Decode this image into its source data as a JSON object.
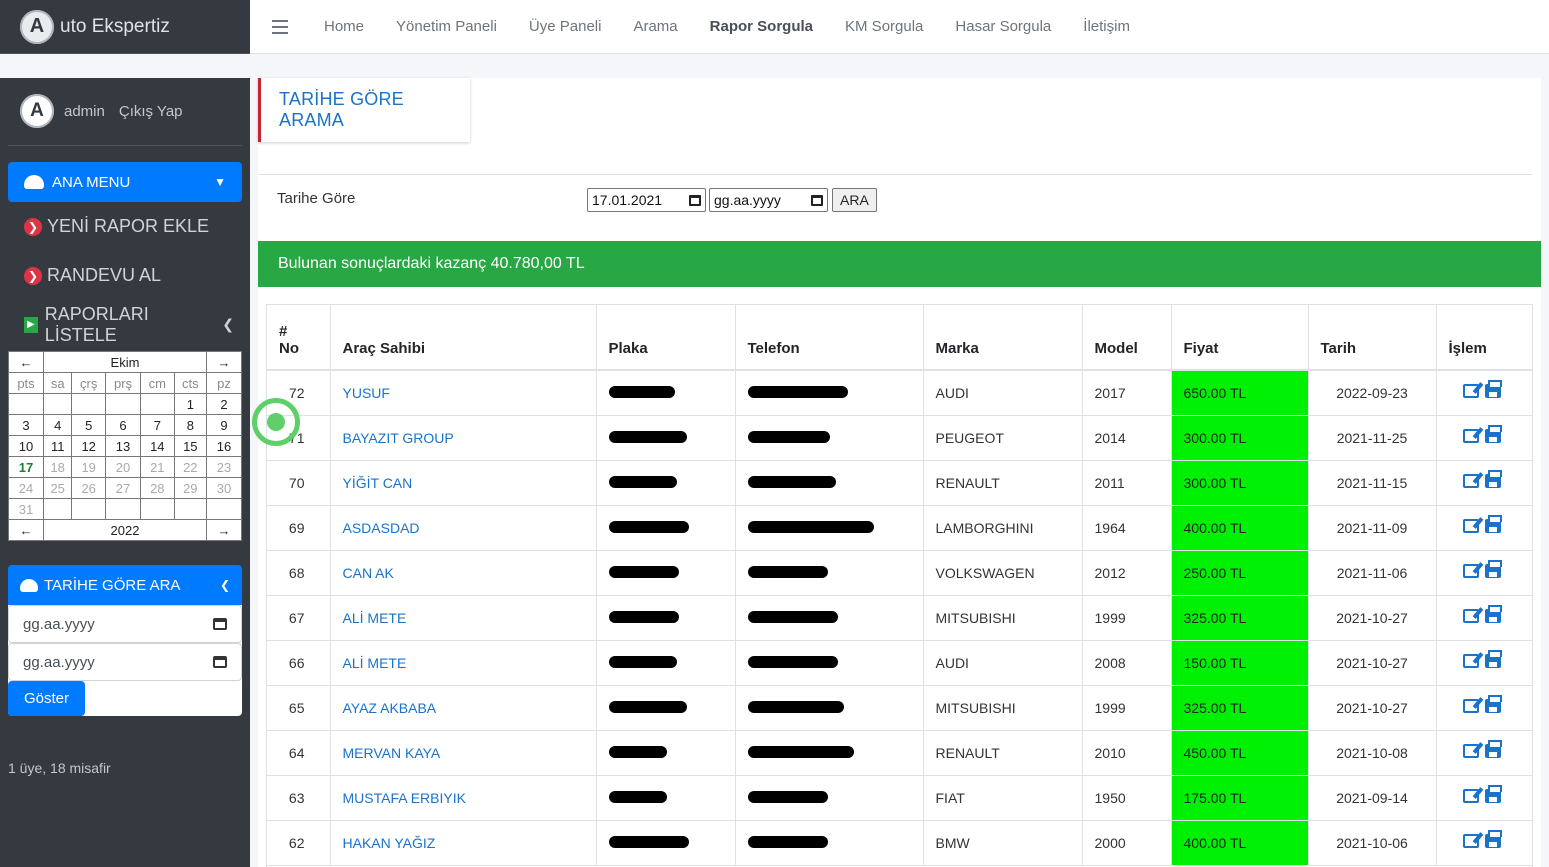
{
  "brand": {
    "logo_letter": "A",
    "text": "uto Ekspertiz"
  },
  "topnav": {
    "items": [
      "Home",
      "Yönetim Paneli",
      "Üye Paneli",
      "Arama",
      "Rapor Sorgula",
      "KM Sorgula",
      "Hasar Sorgula",
      "İletişim"
    ],
    "active": "Rapor Sorgula"
  },
  "sidebar": {
    "user": {
      "avatar_letter": "A",
      "name": "admin",
      "logout": "Çıkış Yap"
    },
    "main_menu": "ANA MENU",
    "items": [
      "YENİ RAPOR EKLE",
      "RANDEVU AL",
      "RAPORLARI LİSTELE"
    ],
    "calendar": {
      "month": "Ekim",
      "year": "2022",
      "days_of_week": [
        "pts",
        "sa",
        "çrş",
        "prş",
        "cm",
        "cts",
        "pz"
      ],
      "weeks": [
        [
          "",
          "",
          "",
          "",
          "",
          "1",
          "2"
        ],
        [
          "3",
          "4",
          "5",
          "6",
          "7",
          "8",
          "9"
        ],
        [
          "10",
          "11",
          "12",
          "13",
          "14",
          "15",
          "16"
        ],
        [
          "17",
          "18",
          "19",
          "20",
          "21",
          "22",
          "23"
        ],
        [
          "24",
          "25",
          "26",
          "27",
          "28",
          "29",
          "30"
        ],
        [
          "31",
          "",
          "",
          "",
          "",
          "",
          ""
        ]
      ],
      "today": "17"
    },
    "date_search": {
      "title": "TARİHE GÖRE ARA",
      "from_placeholder": "gg.aa.yyyy",
      "to_placeholder": "gg.aa.yyyy",
      "button": "Göster"
    },
    "online": "1 üye, 18 misafir"
  },
  "content": {
    "title": "TARİHE GÖRE ARAMA",
    "filter_label": "Tarihe Göre",
    "date_from": "17.01.2021",
    "date_to": "gg.aa.yyyy",
    "search_button": "ARA",
    "alert": "Bulunan sonuçlardaki kazanç 40.780,00 TL",
    "table": {
      "headers": {
        "hash": "#",
        "no": "No",
        "owner": "Araç Sahibi",
        "plate": "Plaka",
        "phone": "Telefon",
        "brand": "Marka",
        "model": "Model",
        "price": "Fiyat",
        "date": "Tarih",
        "action": "İşlem"
      },
      "rows": [
        {
          "no": "72",
          "owner": "YUSUF",
          "brand": "AUDI",
          "model": "2017",
          "price": "650.00 TL",
          "date": "2022-09-23"
        },
        {
          "no": "71",
          "owner": "BAYAZIT GROUP",
          "brand": "PEUGEOT",
          "model": "2014",
          "price": "300.00 TL",
          "date": "2021-11-25"
        },
        {
          "no": "70",
          "owner": "YİĞİT CAN",
          "brand": "RENAULT",
          "model": "2011",
          "price": "300.00 TL",
          "date": "2021-11-15"
        },
        {
          "no": "69",
          "owner": "ASDASDAD",
          "brand": "LAMBORGHINI",
          "model": "1964",
          "price": "400.00 TL",
          "date": "2021-11-09"
        },
        {
          "no": "68",
          "owner": "CAN AK",
          "brand": "VOLKSWAGEN",
          "model": "2012",
          "price": "250.00 TL",
          "date": "2021-11-06"
        },
        {
          "no": "67",
          "owner": "ALİ METE",
          "brand": "MITSUBISHI",
          "model": "1999",
          "price": "325.00 TL",
          "date": "2021-10-27"
        },
        {
          "no": "66",
          "owner": "ALİ METE",
          "brand": "AUDI",
          "model": "2008",
          "price": "150.00 TL",
          "date": "2021-10-27"
        },
        {
          "no": "65",
          "owner": "AYAZ AKBABA",
          "brand": "MITSUBISHI",
          "model": "1999",
          "price": "325.00 TL",
          "date": "2021-10-27"
        },
        {
          "no": "64",
          "owner": "MERVAN KAYA",
          "brand": "RENAULT",
          "model": "2010",
          "price": "450.00 TL",
          "date": "2021-10-08"
        },
        {
          "no": "63",
          "owner": "MUSTAFA ERBIYIK",
          "brand": "FIAT",
          "model": "1950",
          "price": "175.00 TL",
          "date": "2021-09-14"
        },
        {
          "no": "62",
          "owner": "HAKAN YAĞIZ",
          "brand": "BMW",
          "model": "2000",
          "price": "400.00 TL",
          "date": "2021-10-06"
        }
      ]
    }
  },
  "colors": {
    "primary": "#007bff",
    "success": "#28a745",
    "price_bg": "#00f004",
    "danger": "#dc3545",
    "sidebar": "#343a40",
    "link": "#1a73c9"
  }
}
